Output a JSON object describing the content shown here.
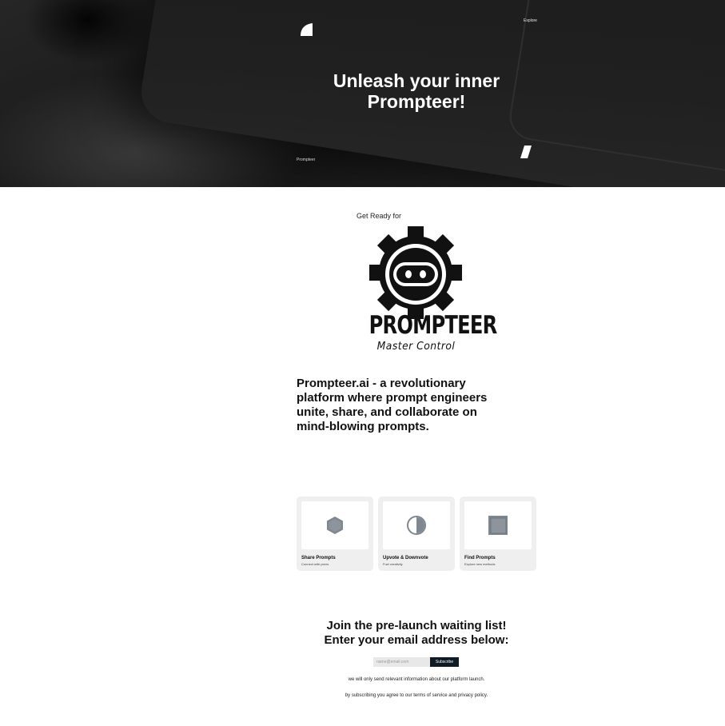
{
  "hero": {
    "nav_link": "Explore",
    "brand": "Prompteer",
    "title_line1": "Unleash your inner",
    "title_line2": "Prompteer!"
  },
  "intro": {
    "kicker": "Get Ready for",
    "logo_word": "PROMPTEER",
    "logo_tagline": "Master Control",
    "tagline": "Prompteer.ai - a revolutionary platform where prompt engineers unite, share, and collaborate on mind-blowing prompts."
  },
  "features": [
    {
      "title": "Share Prompts",
      "subtitle": "Connect with peers",
      "icon": "hexagon-icon"
    },
    {
      "title": "Upvote & Downvote",
      "subtitle": "Fuel creativity",
      "icon": "half-circle-icon"
    },
    {
      "title": "Find Prompts",
      "subtitle": "Explore new methods",
      "icon": "square-icon"
    }
  ],
  "waitlist": {
    "title_line1": "Join the pre-launch waiting list!",
    "title_line2": "Enter your email address below:",
    "email_placeholder": "name@email.com",
    "subscribe_label": "Subscribe",
    "note1": "we will only send relevant information about our platform launch.",
    "note2": "by subscribing you agree to our terms of service and privacy policy."
  },
  "colors": {
    "hero_bg": "#1c1c1c",
    "button_bg": "#0e1a24",
    "card_bg": "#efefef",
    "icon_gray": "#7f8790"
  }
}
